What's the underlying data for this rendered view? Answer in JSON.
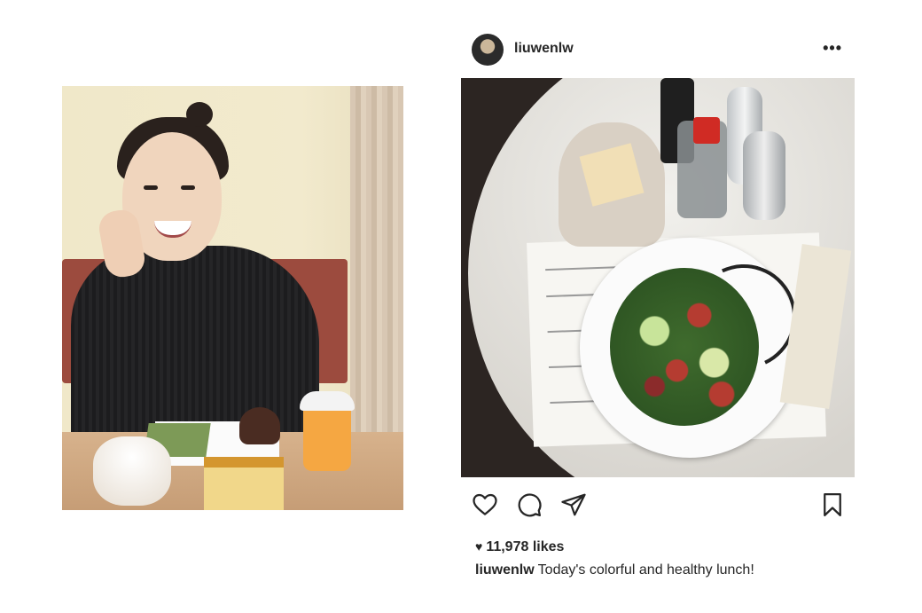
{
  "post": {
    "username": "liuwenlw",
    "more_icon": "more-horizontal-icon",
    "more_glyph": "•••",
    "likes_heart_glyph": "♥",
    "likes_text": "11,978 likes",
    "caption_user": "liuwenlw",
    "caption_text": "Today's colorful and healthy lunch!",
    "actions": [
      "heart-icon",
      "comment-icon",
      "share-icon",
      "bookmark-icon"
    ]
  },
  "colors": {
    "text": "#262626",
    "background": "#ffffff"
  }
}
